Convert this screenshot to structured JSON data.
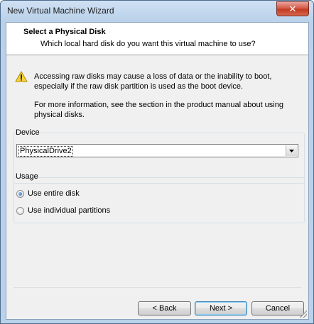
{
  "window": {
    "title": "New Virtual Machine Wizard",
    "close_label": "✕"
  },
  "header": {
    "title": "Select a Physical Disk",
    "subtitle": "Which local hard disk do you want this virtual machine to use?"
  },
  "warning": {
    "icon": "warning-triangle-icon",
    "text": "Accessing raw disks may cause a loss of data or the inability to boot, especially if the raw disk partition is used as the boot device.",
    "info": "For more information, see the section in the product manual about using physical disks."
  },
  "device": {
    "label": "Device",
    "selected": "PhysicalDrive2"
  },
  "usage": {
    "label": "Usage",
    "options": [
      {
        "label": "Use entire disk",
        "checked": true
      },
      {
        "label": "Use individual partitions",
        "checked": false
      }
    ]
  },
  "buttons": {
    "back": "< Back",
    "next": "Next >",
    "cancel": "Cancel"
  },
  "colors": {
    "frame": "#b9d1ea",
    "close": "#c23b22"
  }
}
